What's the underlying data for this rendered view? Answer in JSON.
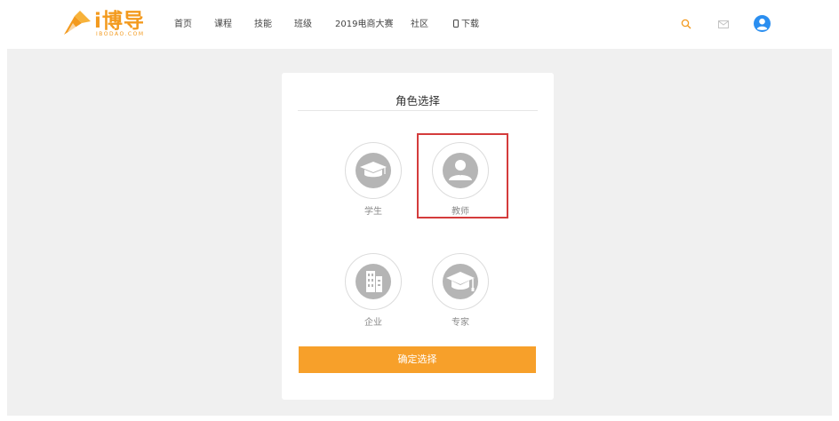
{
  "header": {
    "logo": {
      "name": "i博导",
      "sub": "IBODAO.COM"
    },
    "nav": [
      "首页",
      "课程",
      "技能",
      "班级",
      "2019电商大赛",
      "社区",
      "下载"
    ],
    "icons": [
      "search-icon",
      "mail-icon",
      "user-avatar-icon"
    ]
  },
  "card": {
    "title": "角色选择",
    "roles": [
      {
        "label": "学生",
        "icon": "graduation-cap-icon"
      },
      {
        "label": "教师",
        "icon": "teacher-person-icon",
        "selected": true
      },
      {
        "label": "企业",
        "icon": "building-icon"
      },
      {
        "label": "专家",
        "icon": "expert-cap-icon"
      }
    ],
    "confirm_label": "确定选择"
  },
  "colors": {
    "accent": "#f7a02a",
    "selection_border": "#d43c3c",
    "icon_gray": "#b5b5b5",
    "avatar_blue": "#2a8ef0",
    "background": "#f0f0f0"
  }
}
